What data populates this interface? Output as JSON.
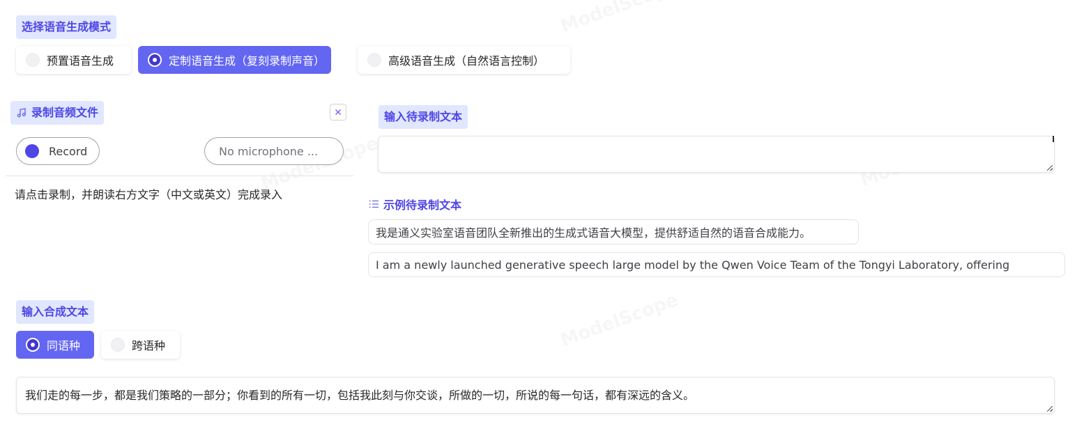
{
  "mode": {
    "label": "选择语音生成模式",
    "options": [
      {
        "label": "预置语音生成",
        "selected": false
      },
      {
        "label": "定制语音生成（复刻录制声音）",
        "selected": true
      },
      {
        "label": "高级语音生成（自然语言控制）",
        "selected": false
      }
    ]
  },
  "record": {
    "label": "录制音频文件",
    "record_button": "Record",
    "microphone": "No microphone ...",
    "hint": "请点击录制，并朗读右方文字（中文或英文）完成录入"
  },
  "prompt_text": {
    "label": "输入待录制文本",
    "value": ""
  },
  "examples": {
    "label": "示例待录制文本",
    "items": [
      "我是通义实验室语音团队全新推出的生成式语音大模型，提供舒适自然的语音合成能力。",
      "I am a newly launched generative speech large model by the Qwen Voice Team of the Tongyi Laboratory, offering"
    ]
  },
  "synth": {
    "label": "输入合成文本",
    "options": [
      {
        "label": "同语种",
        "selected": true
      },
      {
        "label": "跨语种",
        "selected": false
      }
    ],
    "value": "我们走的每一步，都是我们策略的一部分；你看到的所有一切，包括我此刻与你交谈，所做的一切，所说的每一句话，都有深远的含义。"
  },
  "watermark": "ModelScope"
}
